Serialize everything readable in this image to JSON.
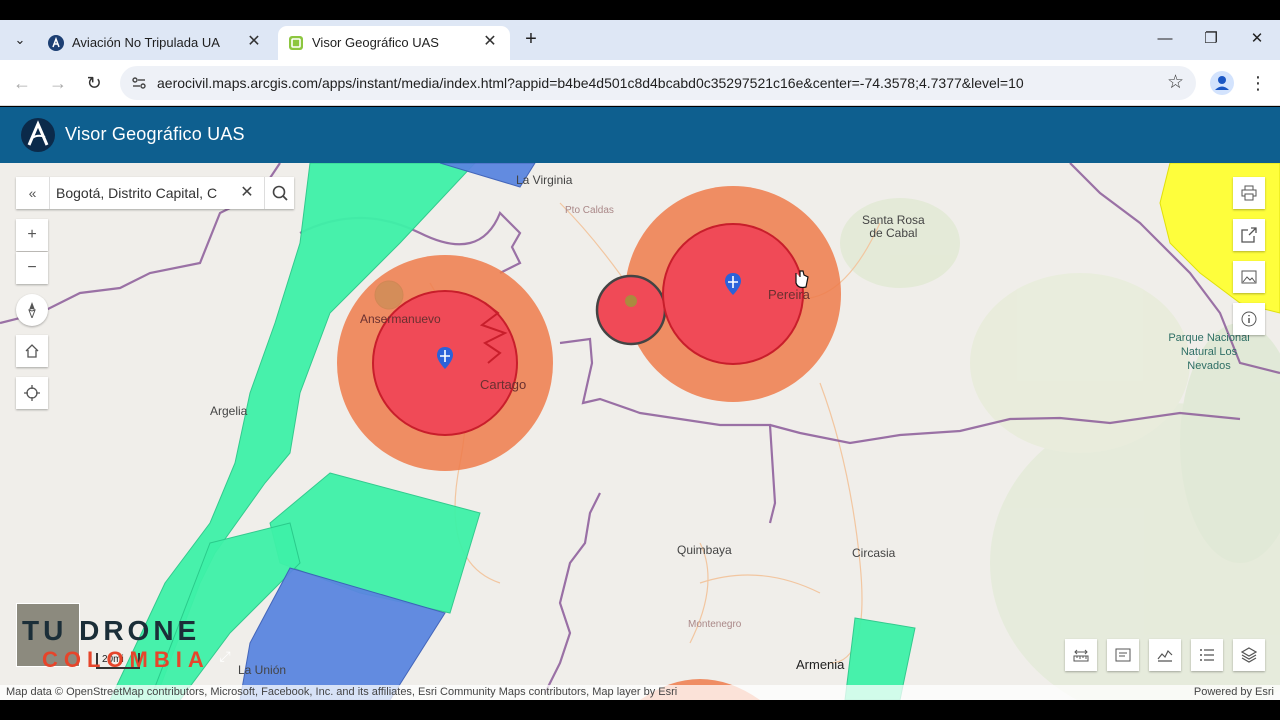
{
  "browser": {
    "tabs": [
      {
        "title": "Aviación No Tripulada UA",
        "active": false,
        "close": "✕"
      },
      {
        "title": "Visor Geográfico UAS",
        "active": true,
        "close": "✕"
      }
    ],
    "new_tab": "+",
    "tab_list": "⌄",
    "window": {
      "minimize": "—",
      "restore": "❐",
      "close": "✕"
    },
    "nav": {
      "back": "←",
      "forward": "→",
      "reload": "↻"
    },
    "url": "aerocivil.maps.arcgis.com/apps/instant/media/index.html?appid=b4be4d501c8d4bcabd0c35297521c16e&center=-74.3578;4.7377&level=10",
    "bookmark": "☆",
    "menu": "⋮"
  },
  "app": {
    "title": "Visor Geográfico UAS",
    "logo_letter": "A"
  },
  "map": {
    "search": {
      "value": "Bogotá, Distrito Capital, C",
      "collapse": "«",
      "clear": "✕"
    },
    "zoom": {
      "in": "+",
      "out": "−"
    },
    "places": {
      "la_virginia": "La Virginia",
      "santa_rosa": "Santa Rosa\nde Cabal",
      "anserma": "Ansermanuevo",
      "pereira": "Pereira",
      "cartago": "Cartago",
      "argelia": "Argelia",
      "quimbaya": "Quimbaya",
      "circasia": "Circasia",
      "montenegro": "Montenegro",
      "armenia": "Armenia",
      "la_union": "La Unión",
      "puerto_caldas": "Pto Caldas",
      "parque": "Parque Nacional\nNatural Los\nNevados"
    },
    "scale": "20mi",
    "attribution": "Map data © OpenStreetMap contributors, Microsoft, Facebook, Inc. and its affiliates, Esri Community Maps contributors, Map layer by Esri",
    "powered_by": "Powered by Esri",
    "watermark": {
      "line1": "TU DRONE",
      "line2": "COLOMBIA"
    },
    "colors": {
      "restricted_core": "#f04a57",
      "restricted_buffer": "#ee7b4b",
      "green_zone": "#3ef2a8",
      "blue_zone": "#5b86e0",
      "yellow_zone": "#ffff33",
      "header": "#0e5f8f"
    }
  }
}
